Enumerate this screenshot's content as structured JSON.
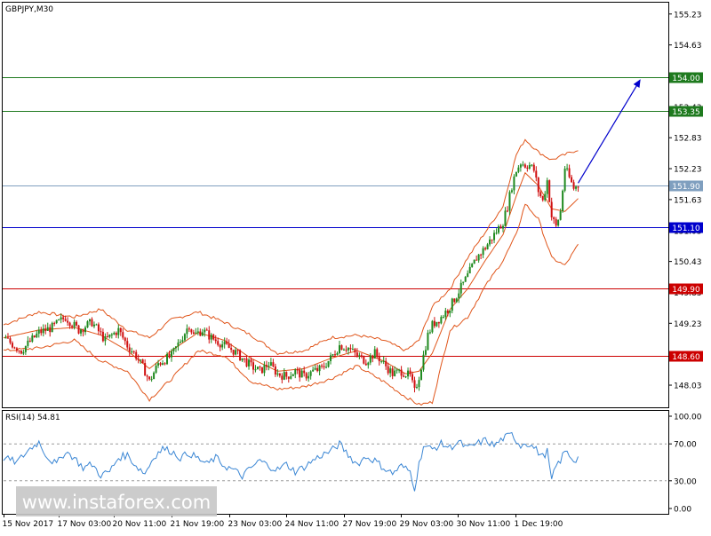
{
  "watermark": "[ www.instaforex.com ]",
  "chart_data": [
    {
      "type": "candlestick",
      "title": "GBPJPY,M30",
      "symbol": "GBPJPY",
      "timeframe": "M30",
      "y_ticks": [
        "155.23",
        "154.63",
        "154.03",
        "153.43",
        "152.83",
        "152.23",
        "151.63",
        "151.03",
        "150.43",
        "149.83",
        "149.23",
        "148.63",
        "148.03"
      ],
      "ylim": [
        147.6,
        155.45
      ],
      "x_ticks": [
        "15 Nov 2017",
        "17 Nov 03:00",
        "20 Nov 11:00",
        "21 Nov 19:00",
        "23 Nov 03:00",
        "24 Nov 11:00",
        "27 Nov 19:00",
        "29 Nov 03:00",
        "30 Nov 11:00",
        "1 Dec 19:00"
      ],
      "levels": [
        {
          "label": "154.00",
          "value": 154.0,
          "color": "#1e7a1e",
          "role": "target"
        },
        {
          "label": "153.35",
          "value": 153.35,
          "color": "#1e7a1e",
          "role": "target"
        },
        {
          "label": "151.90",
          "value": 151.9,
          "color": "#7f9fbf",
          "role": "current price"
        },
        {
          "label": "151.10",
          "value": 151.1,
          "color": "#0000cc",
          "role": "pivot"
        },
        {
          "label": "149.90",
          "value": 149.9,
          "color": "#cc0000",
          "role": "support"
        },
        {
          "label": "148.60",
          "value": 148.6,
          "color": "#cc0000",
          "role": "support"
        }
      ],
      "close_path": [
        [
          0,
          148.95
        ],
        [
          4,
          148.7
        ],
        [
          8,
          149.05
        ],
        [
          11,
          149.15
        ],
        [
          14,
          149.35
        ],
        [
          17,
          149.1
        ],
        [
          20,
          149.25
        ],
        [
          23,
          148.9
        ],
        [
          26,
          149.1
        ],
        [
          28,
          148.8
        ],
        [
          30,
          148.6
        ],
        [
          32,
          148.3
        ],
        [
          33,
          148.1
        ],
        [
          35,
          148.45
        ],
        [
          38,
          148.6
        ],
        [
          40,
          148.9
        ],
        [
          42,
          149.2
        ],
        [
          43,
          149.0
        ],
        [
          45,
          149.1
        ],
        [
          47,
          148.95
        ],
        [
          49,
          148.85
        ],
        [
          52,
          148.7
        ],
        [
          54,
          148.55
        ],
        [
          56,
          148.4
        ],
        [
          58,
          148.3
        ],
        [
          60,
          148.45
        ],
        [
          62,
          148.25
        ],
        [
          64,
          148.2
        ],
        [
          66,
          148.3
        ],
        [
          68,
          148.2
        ],
        [
          70,
          148.3
        ],
        [
          72,
          148.35
        ],
        [
          74,
          148.55
        ],
        [
          76,
          148.8
        ],
        [
          78,
          148.75
        ],
        [
          80,
          148.6
        ],
        [
          82,
          148.5
        ],
        [
          84,
          148.65
        ],
        [
          86,
          148.45
        ],
        [
          88,
          148.25
        ],
        [
          90,
          148.3
        ],
        [
          92,
          148.2
        ],
        [
          93,
          147.9
        ],
        [
          94,
          148.2
        ],
        [
          95,
          148.6
        ],
        [
          96,
          149.0
        ],
        [
          97,
          149.2
        ],
        [
          99,
          149.35
        ],
        [
          101,
          149.55
        ],
        [
          103,
          149.85
        ],
        [
          105,
          150.15
        ],
        [
          107,
          150.5
        ],
        [
          109,
          150.7
        ],
        [
          111,
          150.95
        ],
        [
          113,
          151.2
        ],
        [
          114,
          151.5
        ],
        [
          115,
          151.9
        ],
        [
          116,
          152.2
        ],
        [
          117,
          152.35
        ],
        [
          118,
          152.3
        ],
        [
          119,
          152.3
        ],
        [
          120,
          152.2
        ],
        [
          121,
          151.8
        ],
        [
          122,
          151.6
        ],
        [
          123,
          152.0
        ],
        [
          124,
          151.3
        ],
        [
          125,
          151.1
        ],
        [
          126,
          151.4
        ],
        [
          127,
          152.25
        ],
        [
          128,
          152.05
        ],
        [
          129,
          151.85
        ],
        [
          130,
          151.9
        ]
      ],
      "bollinger": {
        "upper": [
          [
            0,
            149.2
          ],
          [
            8,
            149.45
          ],
          [
            16,
            149.35
          ],
          [
            22,
            149.5
          ],
          [
            28,
            149.1
          ],
          [
            33,
            148.95
          ],
          [
            38,
            149.3
          ],
          [
            44,
            149.45
          ],
          [
            50,
            149.25
          ],
          [
            56,
            149.0
          ],
          [
            62,
            148.65
          ],
          [
            68,
            148.7
          ],
          [
            74,
            148.95
          ],
          [
            80,
            149.0
          ],
          [
            86,
            148.9
          ],
          [
            91,
            148.7
          ],
          [
            94,
            148.9
          ],
          [
            97,
            149.55
          ],
          [
            101,
            149.9
          ],
          [
            105,
            150.5
          ],
          [
            109,
            151.0
          ],
          [
            113,
            151.5
          ],
          [
            116,
            152.5
          ],
          [
            118,
            152.8
          ],
          [
            121,
            152.55
          ],
          [
            124,
            152.4
          ],
          [
            127,
            152.5
          ],
          [
            130,
            152.6
          ]
        ],
        "lower": [
          [
            0,
            148.7
          ],
          [
            8,
            148.75
          ],
          [
            16,
            148.9
          ],
          [
            22,
            148.5
          ],
          [
            28,
            148.3
          ],
          [
            33,
            147.75
          ],
          [
            38,
            148.15
          ],
          [
            44,
            148.7
          ],
          [
            50,
            148.6
          ],
          [
            56,
            148.1
          ],
          [
            62,
            147.95
          ],
          [
            68,
            148.0
          ],
          [
            74,
            148.15
          ],
          [
            80,
            148.4
          ],
          [
            86,
            148.1
          ],
          [
            91,
            147.8
          ],
          [
            94,
            147.65
          ],
          [
            97,
            147.7
          ],
          [
            101,
            149.1
          ],
          [
            105,
            149.35
          ],
          [
            109,
            149.95
          ],
          [
            113,
            150.45
          ],
          [
            116,
            150.95
          ],
          [
            118,
            151.55
          ],
          [
            121,
            151.25
          ],
          [
            124,
            150.5
          ],
          [
            127,
            150.35
          ],
          [
            130,
            150.75
          ]
        ],
        "middle": [
          [
            0,
            148.95
          ],
          [
            8,
            149.1
          ],
          [
            16,
            149.15
          ],
          [
            22,
            149.0
          ],
          [
            28,
            148.7
          ],
          [
            33,
            148.35
          ],
          [
            38,
            148.7
          ],
          [
            44,
            149.05
          ],
          [
            50,
            148.9
          ],
          [
            56,
            148.55
          ],
          [
            62,
            148.3
          ],
          [
            68,
            148.35
          ],
          [
            74,
            148.55
          ],
          [
            80,
            148.7
          ],
          [
            86,
            148.5
          ],
          [
            91,
            148.25
          ],
          [
            94,
            148.3
          ],
          [
            97,
            148.65
          ],
          [
            101,
            149.5
          ],
          [
            105,
            149.9
          ],
          [
            109,
            150.45
          ],
          [
            113,
            150.95
          ],
          [
            116,
            151.7
          ],
          [
            118,
            152.15
          ],
          [
            121,
            151.9
          ],
          [
            124,
            151.45
          ],
          [
            127,
            151.4
          ],
          [
            130,
            151.65
          ]
        ]
      },
      "arrow": {
        "from": [
          130,
          151.95
        ],
        "to": [
          144,
          153.95
        ],
        "color": "#0000cc"
      }
    },
    {
      "type": "line",
      "title": "RSI(14) 54.81",
      "indicator": "RSI",
      "period": 14,
      "last_value": 54.81,
      "y_ticks": [
        "100.00",
        "70.00",
        "30.00",
        "0.00"
      ],
      "ylim": [
        0,
        100
      ],
      "levels": [
        70,
        30
      ],
      "color": "#3a86d4",
      "path": [
        [
          0,
          55
        ],
        [
          3,
          50
        ],
        [
          6,
          65
        ],
        [
          8,
          72
        ],
        [
          10,
          55
        ],
        [
          12,
          48
        ],
        [
          14,
          62
        ],
        [
          16,
          55
        ],
        [
          18,
          44
        ],
        [
          20,
          48
        ],
        [
          22,
          36
        ],
        [
          24,
          40
        ],
        [
          26,
          55
        ],
        [
          28,
          58
        ],
        [
          30,
          46
        ],
        [
          32,
          38
        ],
        [
          34,
          56
        ],
        [
          36,
          65
        ],
        [
          38,
          62
        ],
        [
          40,
          55
        ],
        [
          42,
          60
        ],
        [
          44,
          54
        ],
        [
          46,
          48
        ],
        [
          48,
          55
        ],
        [
          50,
          46
        ],
        [
          52,
          42
        ],
        [
          54,
          35
        ],
        [
          56,
          44
        ],
        [
          58,
          52
        ],
        [
          60,
          46
        ],
        [
          62,
          42
        ],
        [
          64,
          48
        ],
        [
          66,
          40
        ],
        [
          68,
          45
        ],
        [
          70,
          52
        ],
        [
          72,
          58
        ],
        [
          74,
          62
        ],
        [
          76,
          70
        ],
        [
          78,
          58
        ],
        [
          80,
          48
        ],
        [
          82,
          56
        ],
        [
          84,
          52
        ],
        [
          86,
          44
        ],
        [
          88,
          38
        ],
        [
          90,
          46
        ],
        [
          92,
          40
        ],
        [
          93,
          22
        ],
        [
          94,
          48
        ],
        [
          95,
          68
        ],
        [
          97,
          64
        ],
        [
          99,
          70
        ],
        [
          101,
          66
        ],
        [
          103,
          72
        ],
        [
          105,
          65
        ],
        [
          107,
          70
        ],
        [
          109,
          74
        ],
        [
          111,
          68
        ],
        [
          113,
          76
        ],
        [
          115,
          80
        ],
        [
          117,
          68
        ],
        [
          118,
          72
        ],
        [
          120,
          66
        ],
        [
          122,
          56
        ],
        [
          123,
          62
        ],
        [
          124,
          30
        ],
        [
          125,
          46
        ],
        [
          126,
          52
        ],
        [
          127,
          62
        ],
        [
          128,
          58
        ],
        [
          129,
          52
        ],
        [
          130,
          54.81
        ]
      ]
    }
  ]
}
